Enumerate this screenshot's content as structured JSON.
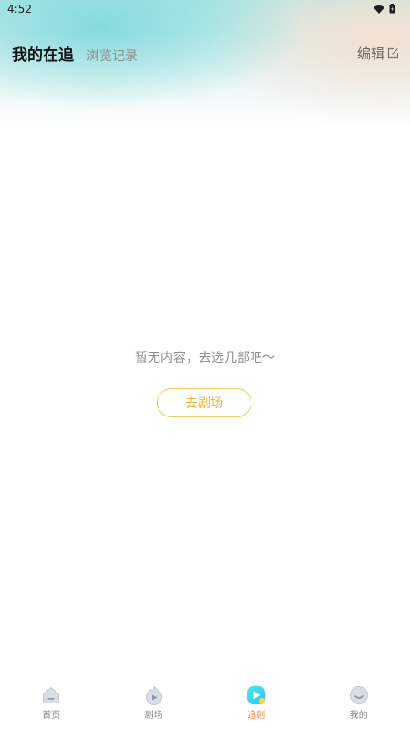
{
  "status_bar": {
    "time": "4:52"
  },
  "header": {
    "tabs": [
      {
        "label": "我的在追",
        "active": true
      },
      {
        "label": "浏览记录",
        "active": false
      }
    ],
    "edit_label": "编辑"
  },
  "empty_state": {
    "message": "暂无内容，去选几部吧～",
    "button_label": "去剧场"
  },
  "bottom_nav": {
    "items": [
      {
        "label": "首页",
        "icon": "home-icon",
        "active": false
      },
      {
        "label": "剧场",
        "icon": "theater-icon",
        "active": false
      },
      {
        "label": "追剧",
        "icon": "follow-play-icon",
        "active": true
      },
      {
        "label": "我的",
        "icon": "profile-icon",
        "active": false
      }
    ]
  },
  "colors": {
    "accent": "#ff8a3d",
    "button_border": "#f1c862",
    "button_text": "#e8b845",
    "header_teal": "#7fd6dc",
    "header_peach": "#fadecd"
  }
}
